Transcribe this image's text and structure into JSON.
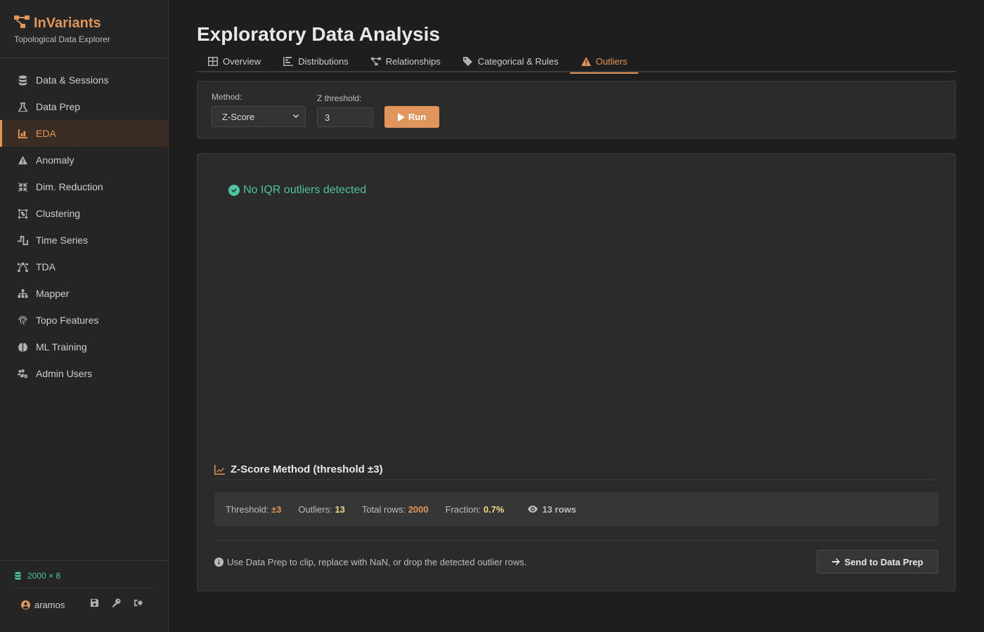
{
  "brand": {
    "title": "InVariants",
    "subtitle": "Topological Data Explorer",
    "accent_color": "#e0955a"
  },
  "sidebar": {
    "items": [
      {
        "label": "Data & Sessions",
        "icon": "database-icon"
      },
      {
        "label": "Data Prep",
        "icon": "flask-icon"
      },
      {
        "label": "EDA",
        "icon": "bar-chart-icon",
        "active": true
      },
      {
        "label": "Anomaly",
        "icon": "warning-icon"
      },
      {
        "label": "Dim. Reduction",
        "icon": "compress-icon"
      },
      {
        "label": "Clustering",
        "icon": "object-group-icon"
      },
      {
        "label": "Time Series",
        "icon": "wave-square-icon"
      },
      {
        "label": "TDA",
        "icon": "bezier-curve-icon"
      },
      {
        "label": "Mapper",
        "icon": "sitemap-icon"
      },
      {
        "label": "Topo Features",
        "icon": "fingerprint-icon"
      },
      {
        "label": "ML Training",
        "icon": "brain-icon"
      },
      {
        "label": "Admin Users",
        "icon": "users-cog-icon"
      }
    ],
    "footer": {
      "dataset_shape": "2000 × 8",
      "username": "aramos"
    }
  },
  "main": {
    "title": "Exploratory Data Analysis",
    "tabs": [
      {
        "label": "Overview",
        "icon": "table-icon"
      },
      {
        "label": "Distributions",
        "icon": "bar-chart-icon"
      },
      {
        "label": "Relationships",
        "icon": "network-icon"
      },
      {
        "label": "Categorical & Rules",
        "icon": "tags-icon"
      },
      {
        "label": "Outliers",
        "icon": "warning-icon",
        "active": true
      }
    ],
    "controls": {
      "method_label": "Method:",
      "method_value": "Z-Score",
      "threshold_label": "Z threshold:",
      "threshold_value": "3",
      "run_label": "Run"
    },
    "results": {
      "iqr_message": "No IQR outliers detected",
      "zscore_title": "Z-Score Method (threshold ±3)",
      "stats": {
        "threshold_label": "Threshold:",
        "threshold_value": "±3",
        "outliers_label": "Outliers:",
        "outliers_value": "13",
        "total_label": "Total rows:",
        "total_value": "2000",
        "fraction_label": "Fraction:",
        "fraction_value": "0.7%",
        "rows_link": "13 rows"
      },
      "note": "Use Data Prep to clip, replace with NaN, or drop the detected outlier rows.",
      "send_label": "Send to Data Prep"
    }
  }
}
